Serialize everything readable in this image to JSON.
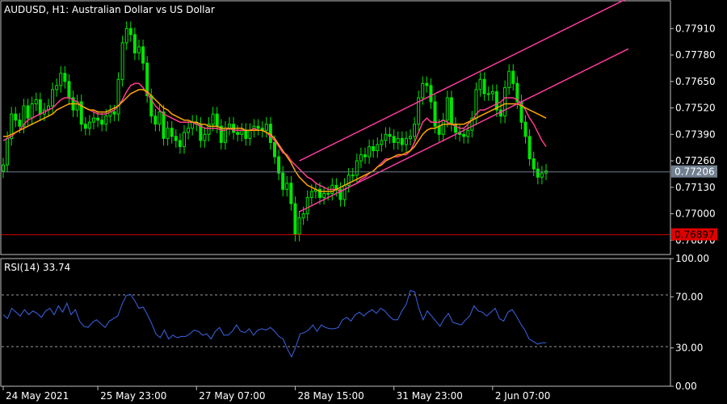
{
  "header": {
    "symbol": "AUDUSD, H1:",
    "description": "Australian Dollar vs US Dollar"
  },
  "indicator": {
    "label": "RSI(14) 33.74"
  },
  "colors": {
    "background": "#000000",
    "candle": "#00e600",
    "frame": "#c0c0c0",
    "ma_fast": "#ff3c8c",
    "ma_slow": "#ffa500",
    "channel": "#ff3ca0",
    "rsi": "#3c64e6",
    "bid_line": "#708090",
    "bid_tag": "#708090",
    "level_line": "#cc0000",
    "level_tag": "#e00000"
  },
  "chart_data": [
    {
      "type": "candlestick",
      "title": "AUDUSD, H1:  Australian Dollar vs US Dollar",
      "price_axis": {
        "ticks": [
          "0.77910",
          "0.77780",
          "0.77650",
          "0.77520",
          "0.77390",
          "0.77260",
          "0.77130",
          "0.77000",
          "0.76870"
        ],
        "ylim": [
          0.768,
          0.7805
        ]
      },
      "time_axis": {
        "ticks": [
          "24 May 2021",
          "25 May 23:00",
          "27 May 07:00",
          "28 May 15:00",
          "31 May 23:00",
          "2 Jun 07:00"
        ]
      },
      "current_price": "0.77206",
      "current_price_value": 0.77206,
      "horizontal_level": "0.76897",
      "horizontal_level_value": 0.76897,
      "series": [
        {
          "kind": "candles",
          "close": [
            0.7724,
            0.7737,
            0.7749,
            0.7746,
            0.7743,
            0.7753,
            0.7747,
            0.7754,
            0.7756,
            0.7749,
            0.7751,
            0.7753,
            0.7761,
            0.7763,
            0.7769,
            0.7765,
            0.7757,
            0.7751,
            0.7755,
            0.7744,
            0.7742,
            0.7745,
            0.7747,
            0.7746,
            0.7744,
            0.7748,
            0.775,
            0.7749,
            0.7766,
            0.7784,
            0.7791,
            0.7788,
            0.7779,
            0.7782,
            0.7774,
            0.7758,
            0.7748,
            0.7744,
            0.775,
            0.7737,
            0.7742,
            0.7738,
            0.7736,
            0.7733,
            0.774,
            0.7742,
            0.7745,
            0.7744,
            0.7736,
            0.7739,
            0.7744,
            0.7749,
            0.7743,
            0.7735,
            0.7742,
            0.7744,
            0.774,
            0.7739,
            0.7741,
            0.7737,
            0.7741,
            0.7743,
            0.7742,
            0.7741,
            0.7744,
            0.7735,
            0.7728,
            0.772,
            0.7712,
            0.7715,
            0.7705,
            0.769,
            0.7698,
            0.77,
            0.7708,
            0.7711,
            0.7712,
            0.7708,
            0.771,
            0.771,
            0.7714,
            0.7712,
            0.7707,
            0.7714,
            0.7719,
            0.7719,
            0.7726,
            0.7729,
            0.7728,
            0.7733,
            0.7731,
            0.7734,
            0.7736,
            0.7739,
            0.7738,
            0.7735,
            0.7737,
            0.7734,
            0.7737,
            0.7738,
            0.7744,
            0.7757,
            0.7764,
            0.7763,
            0.7755,
            0.7743,
            0.7739,
            0.7746,
            0.7757,
            0.7744,
            0.774,
            0.7739,
            0.7738,
            0.7741,
            0.7747,
            0.7761,
            0.7766,
            0.7759,
            0.7759,
            0.776,
            0.7751,
            0.7748,
            0.7762,
            0.777,
            0.7764,
            0.7755,
            0.7745,
            0.7738,
            0.7727,
            0.7722,
            0.7718,
            0.772,
            0.7721
          ]
        },
        {
          "kind": "moving_average",
          "values": [
            0.7736,
            0.7737,
            0.7738,
            0.774,
            0.7741,
            0.7744,
            0.7746,
            0.7747,
            0.7748,
            0.7749,
            0.775,
            0.7751,
            0.7752,
            0.7754,
            0.7756,
            0.7757,
            0.7757,
            0.7756,
            0.7755,
            0.7753,
            0.7752,
            0.7751,
            0.775,
            0.7749,
            0.7749,
            0.7749,
            0.775,
            0.7751,
            0.7753,
            0.7756,
            0.776,
            0.7763,
            0.7764,
            0.7764,
            0.7762,
            0.7759,
            0.7756,
            0.7753,
            0.7751,
            0.7749,
            0.7748,
            0.7747,
            0.7746,
            0.7745,
            0.7745,
            0.7745,
            0.7745,
            0.7744,
            0.7743,
            0.7742,
            0.7742,
            0.7742,
            0.7742,
            0.7741,
            0.7741,
            0.7742,
            0.7741,
            0.7741,
            0.7741,
            0.7741,
            0.7741,
            0.7742,
            0.7741,
            0.7741,
            0.774,
            0.7738,
            0.7736,
            0.7733,
            0.773,
            0.7729,
            0.7726,
            0.7724,
            0.7722,
            0.772,
            0.7718,
            0.7717,
            0.7715,
            0.7714,
            0.7713,
            0.7712,
            0.7712,
            0.7712,
            0.7711,
            0.7712,
            0.7713,
            0.7714,
            0.7715,
            0.7717,
            0.7718,
            0.772,
            0.7721,
            0.7723,
            0.7725,
            0.7727,
            0.7727,
            0.7728,
            0.7728,
            0.7729,
            0.7729,
            0.7731,
            0.7735,
            0.774,
            0.7745,
            0.7747,
            0.7745,
            0.7745,
            0.7745,
            0.7746,
            0.7745,
            0.7744,
            0.7743,
            0.7742,
            0.7742,
            0.7744,
            0.7746,
            0.7749,
            0.7751,
            0.7751,
            0.7752,
            0.7753,
            0.7754,
            0.7755,
            0.7757,
            0.7757,
            0.7757,
            0.7756,
            0.7754,
            0.7751,
            0.7747,
            0.7744,
            0.774,
            0.7736,
            0.7733
          ]
        },
        {
          "kind": "moving_average",
          "values": [
            0.7738,
            0.7738,
            0.7739,
            0.774,
            0.7741,
            0.7742,
            0.7743,
            0.7744,
            0.7745,
            0.7746,
            0.7747,
            0.7748,
            0.7749,
            0.7751,
            0.7752,
            0.7753,
            0.7754,
            0.7754,
            0.7754,
            0.7753,
            0.7752,
            0.7751,
            0.7751,
            0.775,
            0.775,
            0.775,
            0.7751,
            0.7752,
            0.7753,
            0.7755,
            0.7757,
            0.7759,
            0.776,
            0.7761,
            0.7761,
            0.776,
            0.7758,
            0.7756,
            0.7754,
            0.7752,
            0.7751,
            0.7749,
            0.7748,
            0.7747,
            0.7746,
            0.7746,
            0.7745,
            0.7745,
            0.7744,
            0.7744,
            0.7743,
            0.7743,
            0.7743,
            0.7742,
            0.7742,
            0.7742,
            0.7742,
            0.7742,
            0.7742,
            0.7741,
            0.7741,
            0.7741,
            0.7741,
            0.7741,
            0.774,
            0.7739,
            0.7737,
            0.7734,
            0.7731,
            0.7728,
            0.7725,
            0.7721,
            0.7718,
            0.7716,
            0.7714,
            0.7713,
            0.7712,
            0.7711,
            0.7711,
            0.7711,
            0.7711,
            0.7712,
            0.7713,
            0.7714,
            0.7715,
            0.7716,
            0.7717,
            0.7718,
            0.7719,
            0.772,
            0.7721,
            0.7723,
            0.7724,
            0.7726,
            0.7727,
            0.7728,
            0.7729,
            0.7729,
            0.773,
            0.7731,
            0.7733,
            0.7736,
            0.7739,
            0.7741,
            0.7742,
            0.7742,
            0.7743,
            0.7744,
            0.7744,
            0.7744,
            0.7744,
            0.7744,
            0.7744,
            0.7745,
            0.7746,
            0.7747,
            0.7748,
            0.7749,
            0.775,
            0.7751,
            0.7752,
            0.7753,
            0.7754,
            0.7754,
            0.7754,
            0.7754,
            0.7753,
            0.7752,
            0.7751,
            0.775,
            0.7749,
            0.7748,
            0.7747
          ]
        }
      ],
      "channel": {
        "lower": [
          [
            0.7701,
            0.7702,
            0.7703,
            0.7704,
            0.7705,
            0.7706,
            0.7707,
            0.7708,
            0.7709,
            0.771,
            0.7711,
            0.7712,
            0.7713,
            0.7714,
            0.7715,
            0.7716,
            0.7717,
            0.7718,
            0.7719,
            0.772,
            0.7721,
            0.7722,
            0.7723,
            0.7724,
            0.7725,
            0.7726,
            0.7727,
            0.7728,
            0.7729,
            0.773,
            0.7731,
            0.7732,
            0.7733,
            0.7734,
            0.7735,
            0.7736,
            0.7737,
            0.7738,
            0.7739,
            0.774,
            0.7741,
            0.7742,
            0.7743,
            0.7744,
            0.7745,
            0.7746,
            0.7747,
            0.7748,
            0.7749,
            0.775,
            0.7751,
            0.7752,
            0.7753,
            0.7754,
            0.7755,
            0.7756,
            0.7757,
            0.7758,
            0.7759,
            0.776,
            0.7761,
            0.7762,
            0.7763,
            0.7764,
            0.7765,
            0.7766,
            0.7767,
            0.7768,
            0.7769,
            0.777
          ]
        ],
        "upper": [
          [
            0.7726,
            0.7727,
            0.7728,
            0.7729,
            0.773,
            0.7731,
            0.7732,
            0.7733,
            0.7734,
            0.7735,
            0.7736,
            0.7737,
            0.7738,
            0.7739,
            0.774,
            0.7741,
            0.7742,
            0.7743,
            0.7744,
            0.7745,
            0.7746,
            0.7747,
            0.7748,
            0.7749,
            0.775,
            0.7751,
            0.7752,
            0.7753,
            0.7754,
            0.7755,
            0.7756,
            0.7757,
            0.7758,
            0.7759,
            0.776,
            0.7761,
            0.7762,
            0.7763,
            0.7764,
            0.7765,
            0.7766,
            0.7767,
            0.7768,
            0.7769,
            0.777,
            0.7771,
            0.7772,
            0.7773,
            0.7774,
            0.7775,
            0.7776,
            0.7777,
            0.7778,
            0.7779,
            0.778,
            0.7781,
            0.7782,
            0.7783,
            0.7784,
            0.7785,
            0.7786,
            0.7787,
            0.7788,
            0.7789,
            0.779,
            0.7791,
            0.7792,
            0.7793,
            0.7794,
            0.7795
          ]
        ]
      }
    },
    {
      "type": "line",
      "title": "RSI(14) 33.74",
      "value_axis": {
        "ticks": [
          "100.00",
          "70.00",
          "30.00",
          "0.00"
        ],
        "ylim": [
          0,
          100
        ],
        "levels": [
          70,
          30
        ]
      },
      "series": [
        {
          "kind": "rsi",
          "values": [
            56,
            53,
            61,
            58,
            55,
            60,
            56,
            59,
            57,
            54,
            59,
            61,
            56,
            63,
            58,
            65,
            56,
            60,
            51,
            47,
            46,
            50,
            52,
            49,
            46,
            51,
            53,
            55,
            64,
            71,
            72,
            67,
            61,
            62,
            56,
            49,
            41,
            38,
            44,
            37,
            40,
            38,
            39,
            39,
            41,
            44,
            43,
            40,
            41,
            37,
            43,
            46,
            40,
            40,
            43,
            48,
            43,
            42,
            45,
            40,
            44,
            45,
            44,
            46,
            43,
            39,
            37,
            29,
            23,
            31,
            41,
            42,
            44,
            48,
            43,
            48,
            46,
            45,
            45,
            46,
            52,
            54,
            51,
            56,
            58,
            55,
            58,
            60,
            57,
            61,
            59,
            55,
            52,
            52,
            59,
            64,
            75,
            74,
            61,
            52,
            59,
            55,
            51,
            47,
            53,
            57,
            50,
            49,
            48,
            52,
            55,
            63,
            59,
            58,
            55,
            58,
            61,
            53,
            51,
            58,
            60,
            55,
            49,
            44,
            37,
            35,
            33,
            34,
            34
          ]
        }
      ]
    }
  ]
}
